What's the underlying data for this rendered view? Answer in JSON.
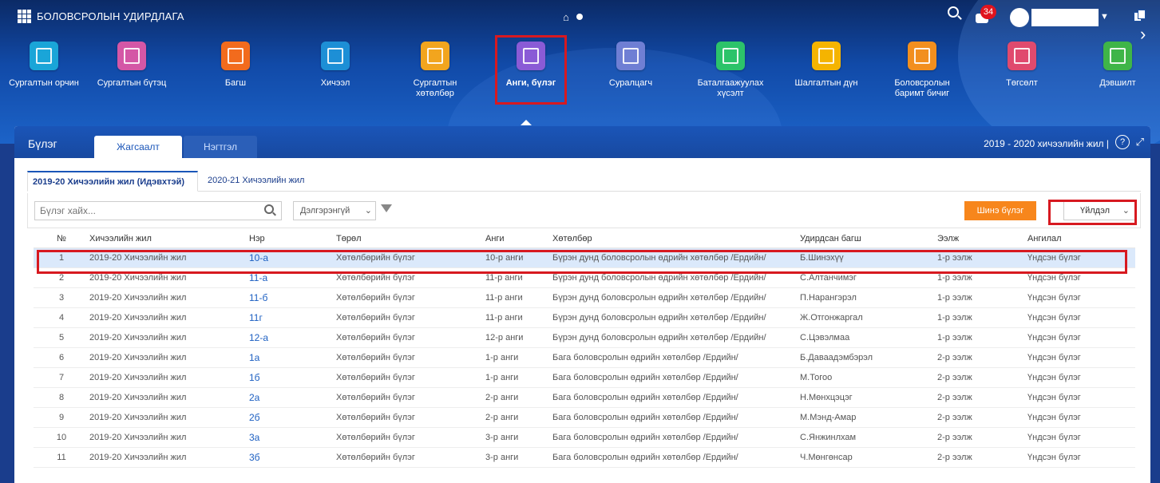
{
  "app": {
    "title": "БОЛОВСРОЛЫН УДИРДЛАГА",
    "notification_count": "34"
  },
  "modules": [
    {
      "label1": "Сургалтын орчин",
      "label2": "",
      "color": "#1aa5d8"
    },
    {
      "label1": "Сургалтын бүтэц",
      "label2": "",
      "color": "#d457a6"
    },
    {
      "label1": "Багш",
      "label2": "",
      "color": "#f26b1d"
    },
    {
      "label1": "Хичээл",
      "label2": "",
      "color": "#1d8fd6"
    },
    {
      "label1": "Сургалтын",
      "label2": "хөтөлбөр",
      "color": "#f2a51e"
    },
    {
      "label1": "Анги, бүлэг",
      "label2": "",
      "color": "#8a5bd6"
    },
    {
      "label1": "Суралцагч",
      "label2": "",
      "color": "#6f7fd4"
    },
    {
      "label1": "Баталгаажуулах",
      "label2": "хүсэлт",
      "color": "#2cc36a"
    },
    {
      "label1": "Шалгалтын дүн",
      "label2": "",
      "color": "#f5b400"
    },
    {
      "label1": "Боловсролын",
      "label2": "баримт бичиг",
      "color": "#f28f1e"
    },
    {
      "label1": "Төгсөлт",
      "label2": "",
      "color": "#e04a6e"
    },
    {
      "label1": "Дэвшилт",
      "label2": "",
      "color": "#3fb548"
    }
  ],
  "panel": {
    "title": "Бүлэг",
    "tab_list": "Жагсаалт",
    "tab_detail": "Нэгтгэл",
    "year_info": "2019 - 2020 хичээлийн жил |",
    "help": "?"
  },
  "subtabs": [
    "2019-20 Хичээлийн жил (Идэвхтэй)",
    "2020-21 Хичээлийн жил"
  ],
  "filter": {
    "search_placeholder": "Бүлэг хайх...",
    "select_value": "Дэлгэрэнгүй",
    "new_button": "Шинэ бүлэг",
    "action_select": "Үйлдэл"
  },
  "table": {
    "headers": [
      "№",
      "Хичээлийн жил",
      "Нэр",
      "Төрөл",
      "Анги",
      "Хөтөлбөр",
      "Удирдсан багш",
      "Ээлж",
      "Ангилал"
    ],
    "rows": [
      [
        "1",
        "2019-20 Хичээлийн жил",
        "10-а",
        "Хөтөлбөрийн бүлэг",
        "10-р анги",
        "Бүрэн дунд боловсролын өдрийн хөтөлбөр /Ердийн/",
        "Б.Шинэхүү",
        "1-р ээлж",
        "Үндсэн бүлэг"
      ],
      [
        "2",
        "2019-20 Хичээлийн жил",
        "11-а",
        "Хөтөлбөрийн бүлэг",
        "11-р анги",
        "Бүрэн дунд боловсролын өдрийн хөтөлбөр /Ердийн/",
        "С.Алтанчимэг",
        "1-р ээлж",
        "Үндсэн бүлэг"
      ],
      [
        "3",
        "2019-20 Хичээлийн жил",
        "11-б",
        "Хөтөлбөрийн бүлэг",
        "11-р анги",
        "Бүрэн дунд боловсролын өдрийн хөтөлбөр /Ердийн/",
        "П.Нарангэрэл",
        "1-р ээлж",
        "Үндсэн бүлэг"
      ],
      [
        "4",
        "2019-20 Хичээлийн жил",
        "11г",
        "Хөтөлбөрийн бүлэг",
        "11-р анги",
        "Бүрэн дунд боловсролын өдрийн хөтөлбөр /Ердийн/",
        "Ж.Отгонжаргал",
        "1-р ээлж",
        "Үндсэн бүлэг"
      ],
      [
        "5",
        "2019-20 Хичээлийн жил",
        "12-а",
        "Хөтөлбөрийн бүлэг",
        "12-р анги",
        "Бүрэн дунд боловсролын өдрийн хөтөлбөр /Ердийн/",
        "С.Цэвэлмаа",
        "1-р ээлж",
        "Үндсэн бүлэг"
      ],
      [
        "6",
        "2019-20 Хичээлийн жил",
        "1а",
        "Хөтөлбөрийн бүлэг",
        "1-р анги",
        "Бага боловсролын өдрийн хөтөлбөр /Ердийн/",
        "Б.Даваадэмбэрэл",
        "2-р ээлж",
        "Үндсэн бүлэг"
      ],
      [
        "7",
        "2019-20 Хичээлийн жил",
        "1б",
        "Хөтөлбөрийн бүлэг",
        "1-р анги",
        "Бага боловсролын өдрийн хөтөлбөр /Ердийн/",
        "М.Тогоо",
        "2-р ээлж",
        "Үндсэн бүлэг"
      ],
      [
        "8",
        "2019-20 Хичээлийн жил",
        "2а",
        "Хөтөлбөрийн бүлэг",
        "2-р анги",
        "Бага боловсролын өдрийн хөтөлбөр /Ердийн/",
        "Н.Мөнхцэцэг",
        "2-р ээлж",
        "Үндсэн бүлэг"
      ],
      [
        "9",
        "2019-20 Хичээлийн жил",
        "2б",
        "Хөтөлбөрийн бүлэг",
        "2-р анги",
        "Бага боловсролын өдрийн хөтөлбөр /Ердийн/",
        "М.Мэнд-Амар",
        "2-р ээлж",
        "Үндсэн бүлэг"
      ],
      [
        "10",
        "2019-20 Хичээлийн жил",
        "3а",
        "Хөтөлбөрийн бүлэг",
        "3-р анги",
        "Бага боловсролын өдрийн хөтөлбөр /Ердийн/",
        "С.Янжинлхам",
        "2-р ээлж",
        "Үндсэн бүлэг"
      ],
      [
        "11",
        "2019-20 Хичээлийн жил",
        "3б",
        "Хөтөлбөрийн бүлэг",
        "3-р анги",
        "Бага боловсролын өдрийн хөтөлбөр /Ердийн/",
        "Ч.Мөнгөнсар",
        "2-р ээлж",
        "Үндсэн бүлэг"
      ]
    ]
  }
}
